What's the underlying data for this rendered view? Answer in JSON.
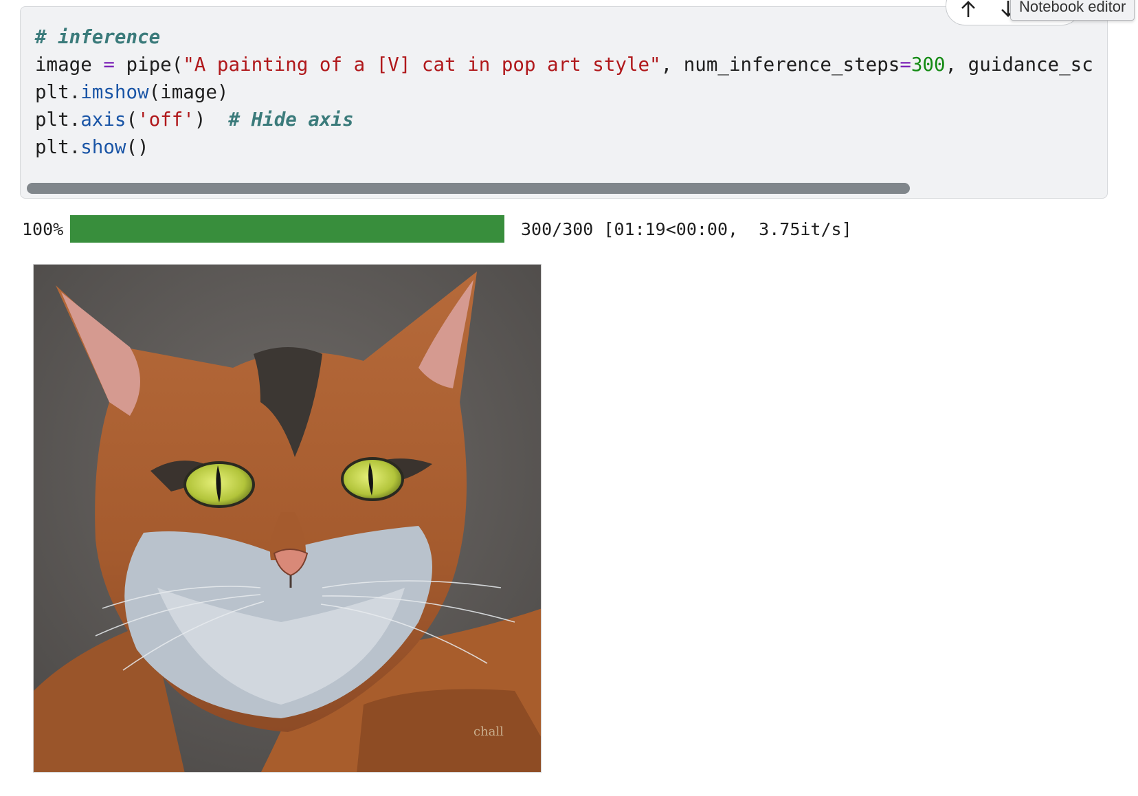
{
  "cell": {
    "code_lines": [
      [
        {
          "t": "comment",
          "v": "# inference"
        }
      ],
      [
        {
          "t": "plain",
          "v": "image "
        },
        {
          "t": "op",
          "v": "="
        },
        {
          "t": "plain",
          "v": " pipe("
        },
        {
          "t": "string",
          "v": "\"A painting of a [V] cat in pop art style\""
        },
        {
          "t": "plain",
          "v": ", num_inference_steps"
        },
        {
          "t": "op",
          "v": "="
        },
        {
          "t": "num",
          "v": "300"
        },
        {
          "t": "plain",
          "v": ", guidance_sc"
        }
      ],
      [
        {
          "t": "plain",
          "v": "plt."
        },
        {
          "t": "func",
          "v": "imshow"
        },
        {
          "t": "plain",
          "v": "(image)"
        }
      ],
      [
        {
          "t": "plain",
          "v": "plt."
        },
        {
          "t": "func",
          "v": "axis"
        },
        {
          "t": "plain",
          "v": "("
        },
        {
          "t": "string",
          "v": "'off'"
        },
        {
          "t": "plain",
          "v": ")  "
        },
        {
          "t": "comment",
          "v": "# Hide axis"
        }
      ],
      [
        {
          "t": "plain",
          "v": "plt."
        },
        {
          "t": "func",
          "v": "show"
        },
        {
          "t": "plain",
          "v": "()"
        }
      ]
    ],
    "toolbar_icons": [
      "arrow-up-icon",
      "arrow-down-icon",
      "delete-icon"
    ],
    "tooltip": "Notebook editor"
  },
  "output": {
    "progress_percent_label": "100%",
    "progress_value": 1.0,
    "progress_stats": "300/300 [01:19<00:00,  3.75it/s]",
    "bar_color": "#388e3c",
    "image_alt": "cat painting"
  }
}
